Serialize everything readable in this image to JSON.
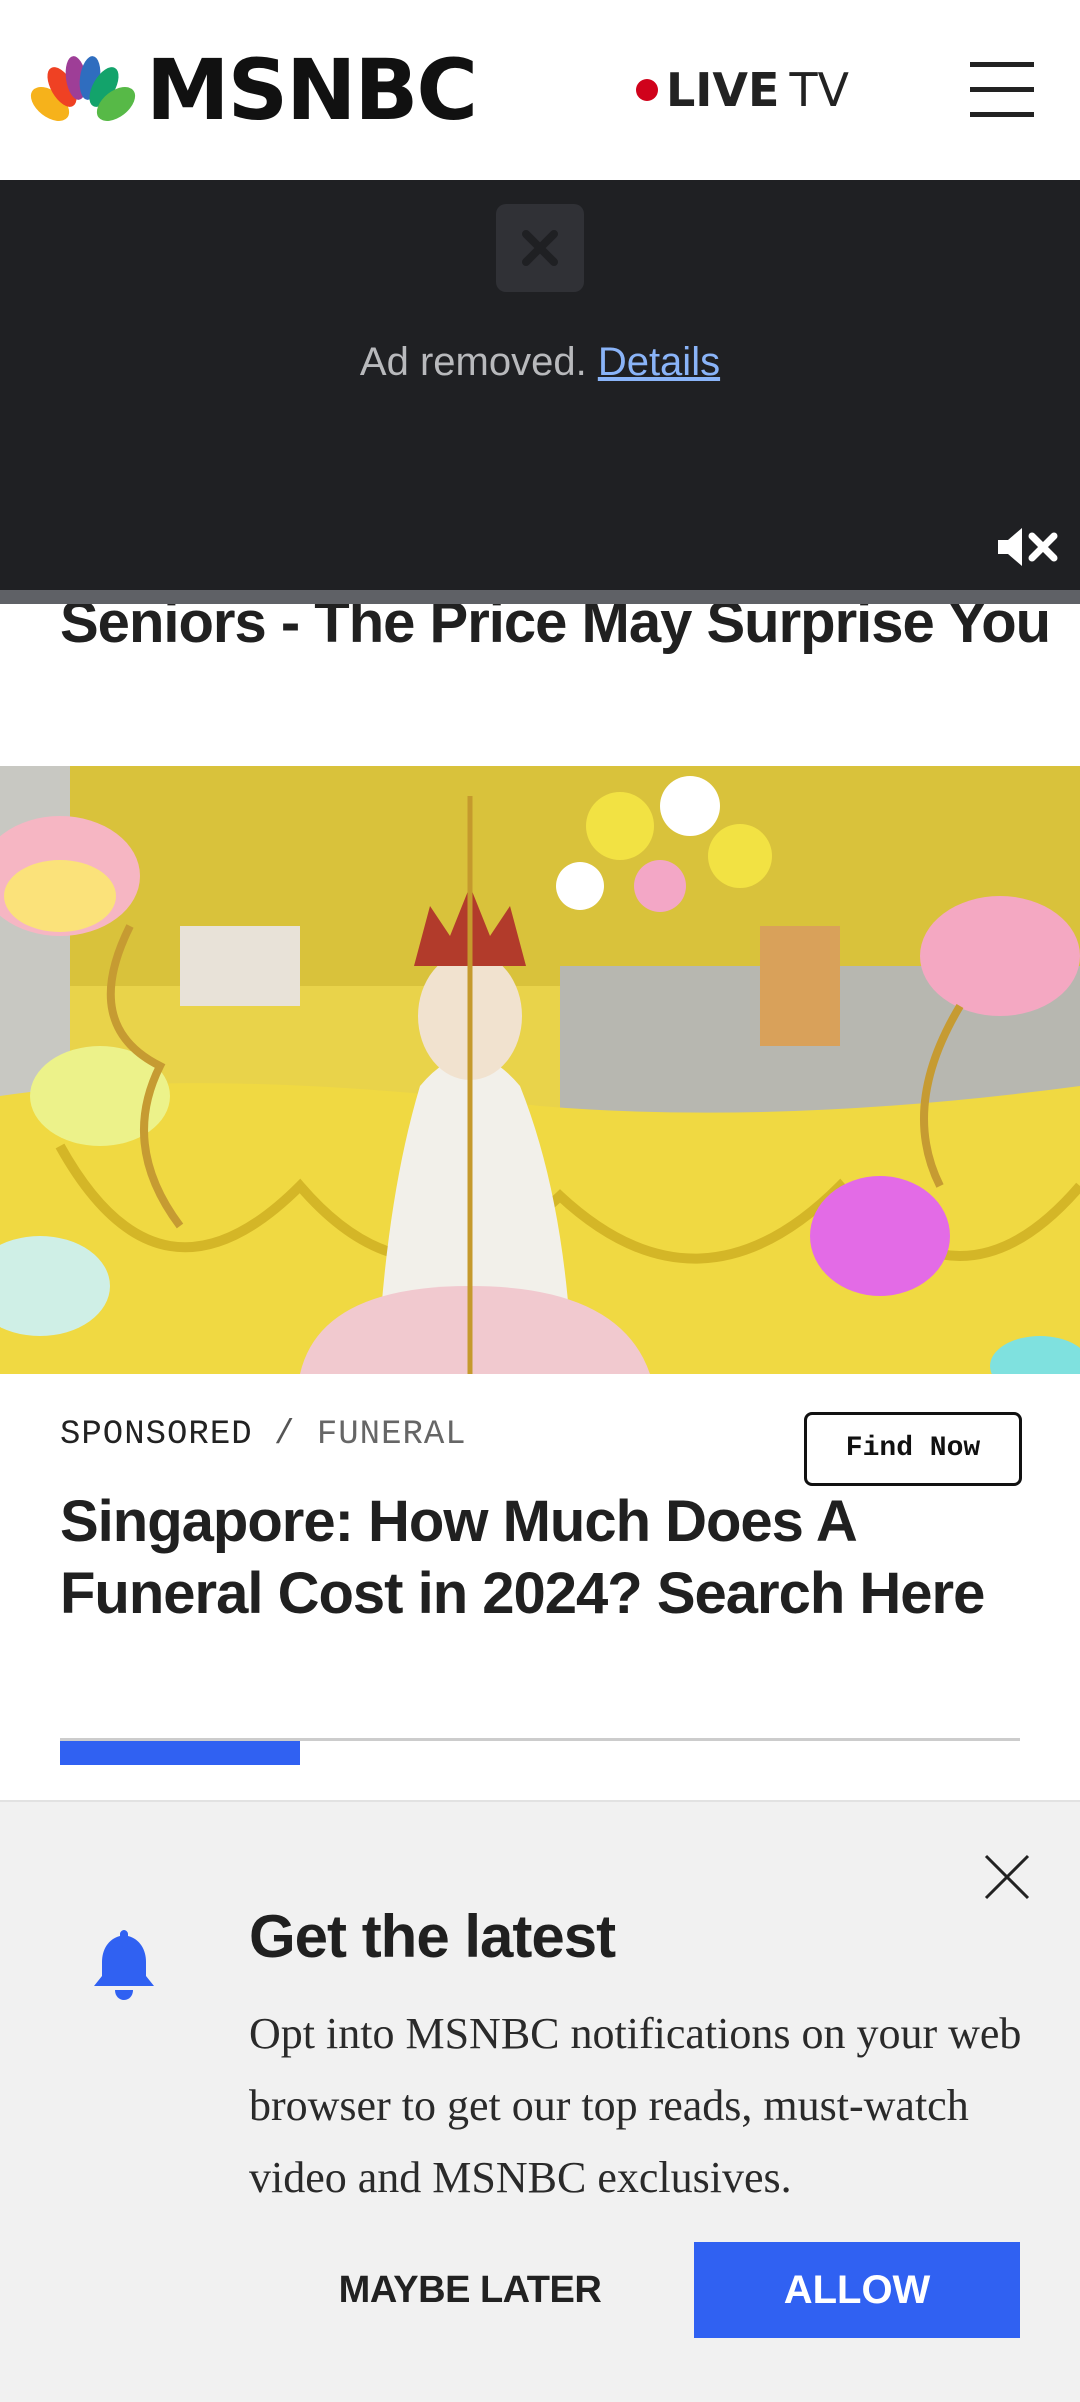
{
  "header": {
    "brand": "MSNBC",
    "live_label": "LIVE",
    "tv_label": "TV"
  },
  "video": {
    "ad_message": "Ad removed.",
    "ad_link": "Details",
    "mute_icon": "volume-mute-icon"
  },
  "article_peek": {
    "title": "Seniors - The Price May Surprise You"
  },
  "sponsored": {
    "tag_primary": "SPONSORED",
    "tag_separator": "/",
    "tag_secondary": "FUNERAL",
    "cta_label": "Find Now",
    "title": "Singapore: How Much Does A Funeral Cost in 2024? Search Here",
    "carousel_progress": 0.25
  },
  "notification_prompt": {
    "title": "Get the latest",
    "body": "Opt into MSNBC notifications on your web browser to get our top reads, must-watch video and MSNBC exclusives.",
    "later_label": "MAYBE LATER",
    "allow_label": "ALLOW",
    "icon": "bell-icon",
    "accent_color": "#3061f2"
  }
}
